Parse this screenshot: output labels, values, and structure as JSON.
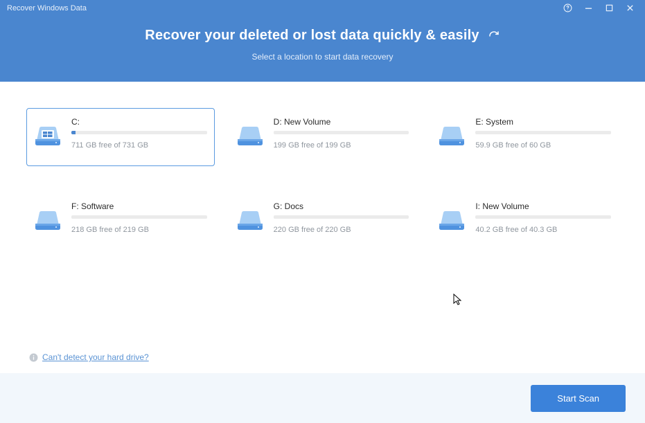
{
  "titlebar": {
    "title": "Recover Windows Data"
  },
  "header": {
    "headline": "Recover your deleted or lost data quickly & easily",
    "subtitle": "Select a location to start data recovery"
  },
  "drives": [
    {
      "name": "C:",
      "free_label": "711 GB free of 731 GB",
      "used_pct": 3,
      "selected": true,
      "os_logo": true
    },
    {
      "name": "D: New Volume",
      "free_label": "199 GB free of 199 GB",
      "used_pct": 0,
      "selected": false,
      "os_logo": false
    },
    {
      "name": "E: System",
      "free_label": "59.9 GB free of 60 GB",
      "used_pct": 0,
      "selected": false,
      "os_logo": false
    },
    {
      "name": "F: Software",
      "free_label": "218 GB free of 219 GB",
      "used_pct": 0,
      "selected": false,
      "os_logo": false
    },
    {
      "name": "G: Docs",
      "free_label": "220 GB free of 220 GB",
      "used_pct": 0,
      "selected": false,
      "os_logo": false
    },
    {
      "name": "I: New Volume",
      "free_label": "40.2 GB free of 40.3 GB",
      "used_pct": 0,
      "selected": false,
      "os_logo": false
    }
  ],
  "detect_link": "Can't detect your hard drive?",
  "scan_button": "Start Scan"
}
